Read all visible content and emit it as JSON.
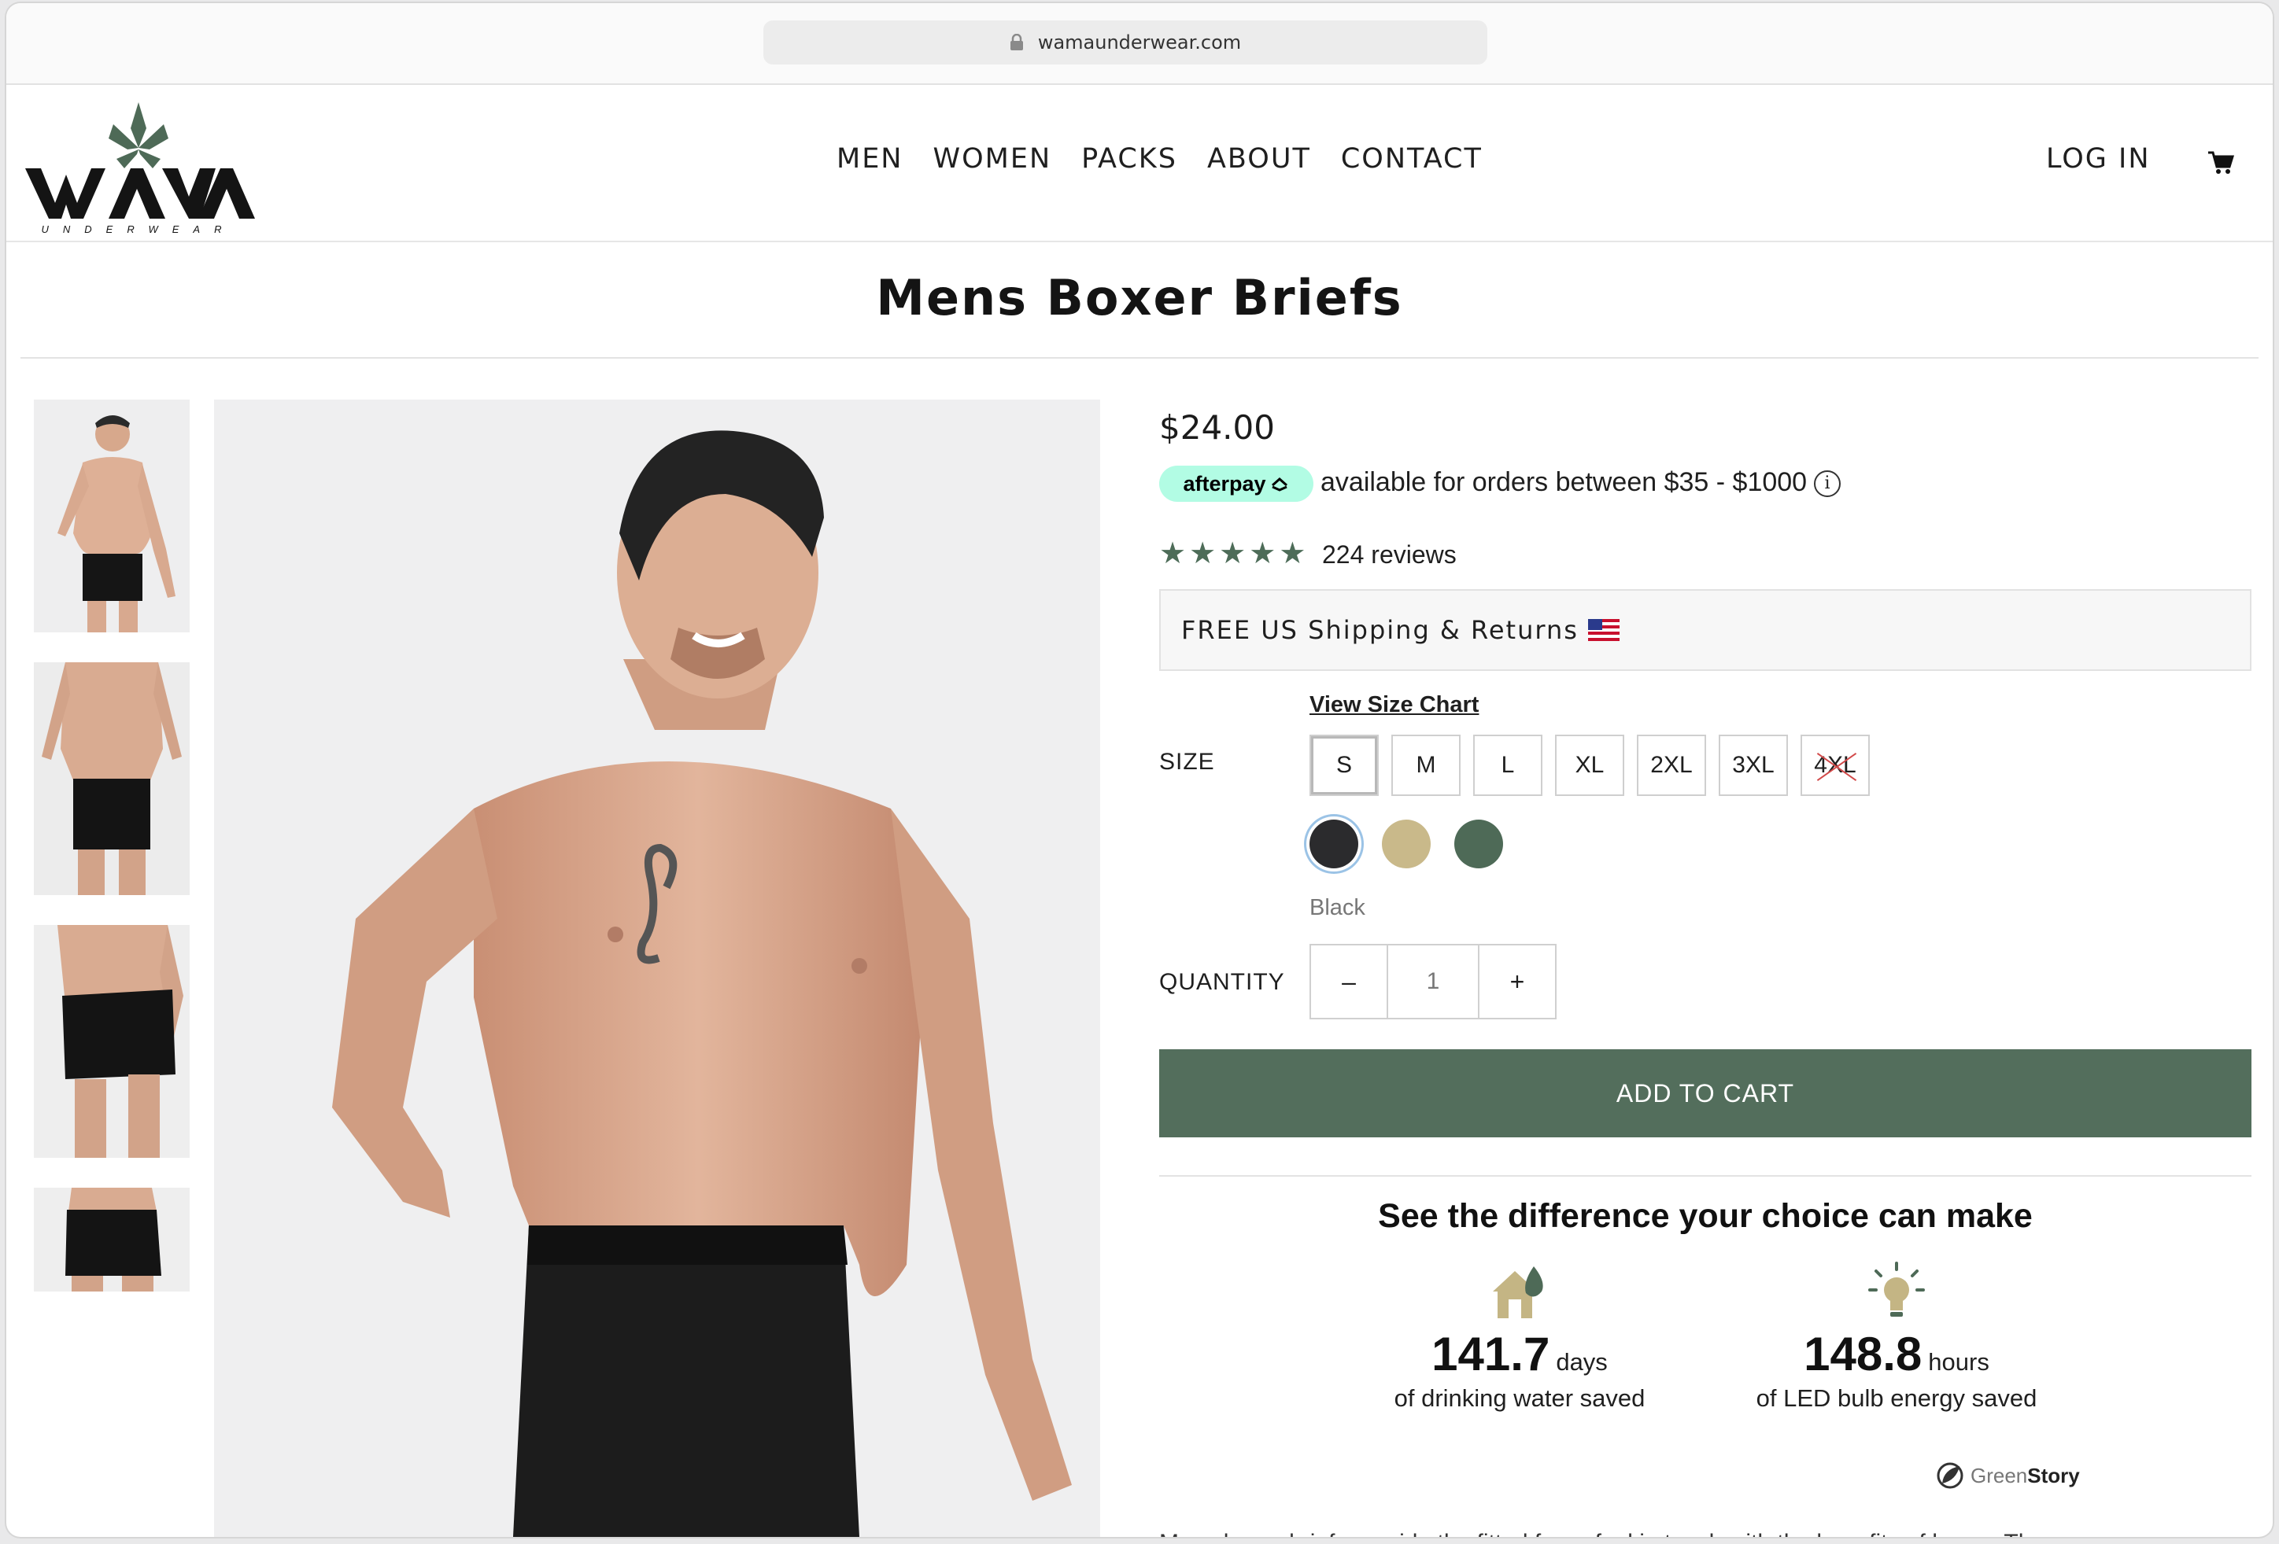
{
  "browser": {
    "url": "wamaunderwear.com"
  },
  "brand": {
    "name": "WAMA",
    "tagline": "UNDERWEAR"
  },
  "nav": {
    "items": [
      "MEN",
      "WOMEN",
      "PACKS",
      "ABOUT",
      "CONTACT"
    ],
    "login": "LOG IN"
  },
  "product": {
    "title": "Mens Boxer Briefs",
    "price": "$24.00",
    "afterpay": {
      "badge": "afterpay",
      "text": "available for orders between $35 - $1000"
    },
    "rating": {
      "stars": 5,
      "reviews": "224 reviews"
    },
    "shipping": "FREE US Shipping & Returns",
    "size_chart_link": "View Size Chart",
    "size_label": "SIZE",
    "sizes": [
      "S",
      "M",
      "L",
      "XL",
      "2XL",
      "3XL",
      "4XL"
    ],
    "colors": [
      {
        "name": "Black",
        "hex": "#2b2b2d"
      },
      {
        "name": "Tan",
        "hex": "#c9b98a"
      },
      {
        "name": "Green",
        "hex": "#4e6a57"
      }
    ],
    "selected_color": "Black",
    "quantity_label": "QUANTITY",
    "quantity": "1",
    "minus": "–",
    "plus": "+",
    "add_to_cart": "ADD TO CART",
    "accent_color": "#536e5c"
  },
  "impact": {
    "title": "See the difference your choice can make",
    "items": [
      {
        "value": "141.7",
        "unit": "days",
        "desc": "of drinking water saved"
      },
      {
        "value": "148.8",
        "unit": "hours",
        "desc": "of LED bulb energy saved"
      }
    ],
    "badge_a": "Green",
    "badge_b": "Story"
  },
  "description_start": "Mens boxer briefs provide the fitted for ... feel in touch with the benefits of hemp. The"
}
